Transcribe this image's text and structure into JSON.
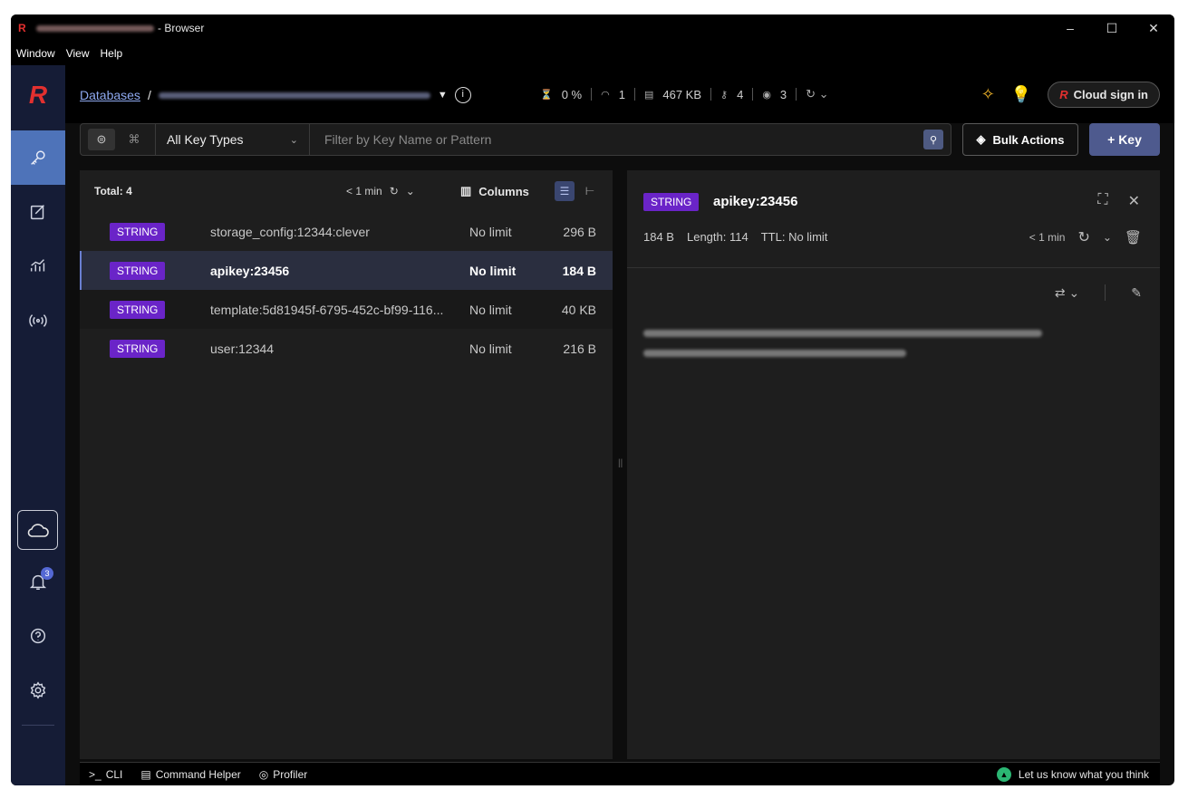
{
  "titlebar": {
    "title_suffix": "- Browser",
    "min": "–",
    "max": "☐",
    "close": "✕"
  },
  "menu": [
    "Window",
    "View",
    "Help"
  ],
  "sidebar": {
    "notifications_count": "3"
  },
  "header": {
    "databases_link": "Databases",
    "sep": "/",
    "stats": {
      "cpu": "0 %",
      "connections": "1",
      "memory": "467 KB",
      "keys": "4",
      "users": "3"
    },
    "cloud_signin": "Cloud sign in"
  },
  "filter": {
    "key_types": "All Key Types",
    "placeholder": "Filter by Key Name or Pattern",
    "bulk_actions": "Bulk Actions",
    "add_key": "+ Key"
  },
  "list": {
    "total": "Total: 4",
    "refresh_time": "< 1 min",
    "columns": "Columns",
    "rows": [
      {
        "type": "STRING",
        "name": "storage_config:12344:clever",
        "ttl": "No limit",
        "size": "296 B"
      },
      {
        "type": "STRING",
        "name": "apikey:23456",
        "ttl": "No limit",
        "size": "184 B"
      },
      {
        "type": "STRING",
        "name": "template:5d81945f-6795-452c-bf99-116...",
        "ttl": "No limit",
        "size": "40 KB"
      },
      {
        "type": "STRING",
        "name": "user:12344",
        "ttl": "No limit",
        "size": "216 B"
      }
    ]
  },
  "detail": {
    "type": "STRING",
    "key": "apikey:23456",
    "size": "184 B",
    "length": "Length: 114",
    "ttl_label": "TTL:",
    "ttl": "No limit",
    "refresh_time": "< 1 min"
  },
  "bottom": {
    "cli": "CLI",
    "command_helper": "Command Helper",
    "profiler": "Profiler",
    "feedback": "Let us know what you think"
  }
}
